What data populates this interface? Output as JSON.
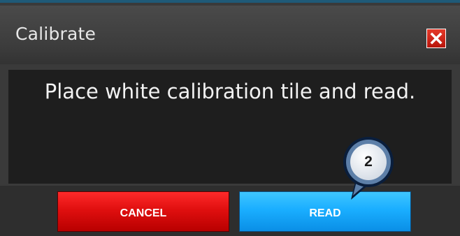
{
  "dialog": {
    "title": "Calibrate",
    "message": "Place white calibration tile and read.",
    "close_icon": "close-icon"
  },
  "buttons": {
    "cancel_label": "CANCEL",
    "read_label": "READ"
  },
  "callout": {
    "step_number": "2",
    "icon": "step-callout-badge"
  },
  "colors": {
    "cancel": "#e00f0f",
    "read": "#1aaeff",
    "close": "#d0261a",
    "panel": "#1e1e1e",
    "titlebar": "#3a3a3a"
  }
}
